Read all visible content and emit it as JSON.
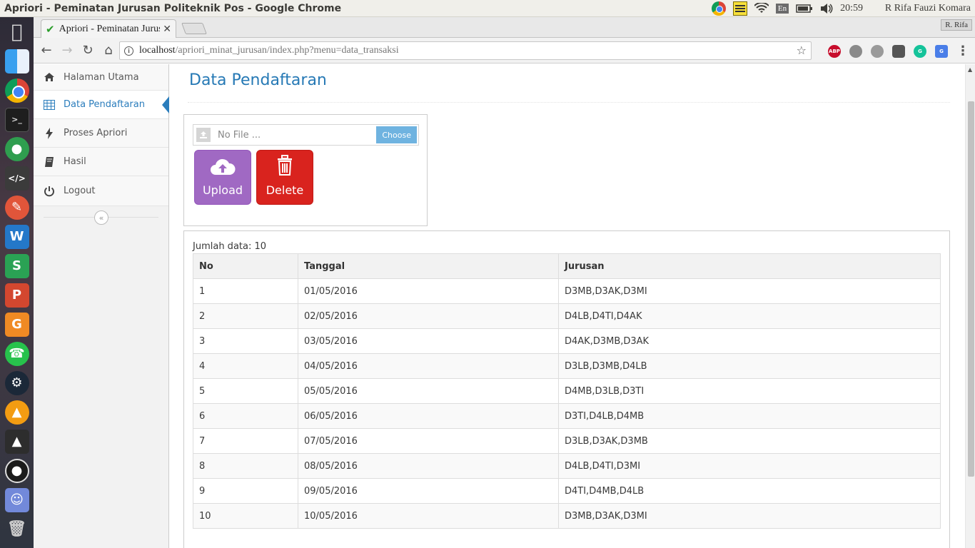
{
  "window": {
    "title": "Apriori - Peminatan Jurusan Politeknik Pos - Google Chrome"
  },
  "tray": {
    "lang": "En",
    "time": "20:59",
    "user": "R Rifa Fauzi Komara"
  },
  "launcher": {
    "items": [
      "apple-icon",
      "finder-icon",
      "chrome-icon",
      "terminal-icon",
      "android-icon",
      "code-editor-icon",
      "pen-icon",
      "wps-writer-icon",
      "wps-spreadsheet-icon",
      "wps-presentation-icon",
      "pdf-icon",
      "whatsapp-icon",
      "steam-icon",
      "vlc-icon",
      "inkscape-icon",
      "obs-icon",
      "discord-icon",
      "trash-icon"
    ]
  },
  "browser": {
    "tab_title": "Apriori - Peminatan Jurusan Politeknik Pos",
    "profile": "R. Rifa",
    "url_host": "localhost",
    "url_path": "/apriori_minat_jurusan/index.php?menu=data_transaksi",
    "ext_abp": "ABP"
  },
  "sidebar": {
    "items": [
      {
        "label": "Halaman Utama",
        "icon": "home-icon"
      },
      {
        "label": "Data Pendaftaran",
        "icon": "table-icon"
      },
      {
        "label": "Proses Apriori",
        "icon": "bolt-icon"
      },
      {
        "label": "Hasil",
        "icon": "book-icon"
      },
      {
        "label": "Logout",
        "icon": "power-icon"
      }
    ],
    "active_index": 1
  },
  "main": {
    "page_title": "Data Pendaftaran",
    "file_placeholder": "No File ...",
    "choose_label": "Choose",
    "upload_label": "Upload",
    "delete_label": "Delete",
    "count_label": "Jumlah data: 10"
  },
  "table": {
    "columns": [
      "No",
      "Tanggal",
      "Jurusan"
    ],
    "rows": [
      [
        "1",
        "01/05/2016",
        "D3MB,D3AK,D3MI"
      ],
      [
        "2",
        "02/05/2016",
        "D4LB,D4TI,D4AK"
      ],
      [
        "3",
        "03/05/2016",
        "D4AK,D3MB,D3AK"
      ],
      [
        "4",
        "04/05/2016",
        "D3LB,D3MB,D4LB"
      ],
      [
        "5",
        "05/05/2016",
        "D4MB,D3LB,D3TI"
      ],
      [
        "6",
        "06/05/2016",
        "D3TI,D4LB,D4MB"
      ],
      [
        "7",
        "07/05/2016",
        "D3LB,D3AK,D3MB"
      ],
      [
        "8",
        "08/05/2016",
        "D4LB,D4TI,D3MI"
      ],
      [
        "9",
        "09/05/2016",
        "D4TI,D4MB,D4LB"
      ],
      [
        "10",
        "10/05/2016",
        "D3MB,D3AK,D3MI"
      ]
    ]
  },
  "colors": {
    "accent": "#2679b5",
    "upload": "#a069c3",
    "delete": "#d9231e",
    "choose": "#6fb3e0"
  }
}
